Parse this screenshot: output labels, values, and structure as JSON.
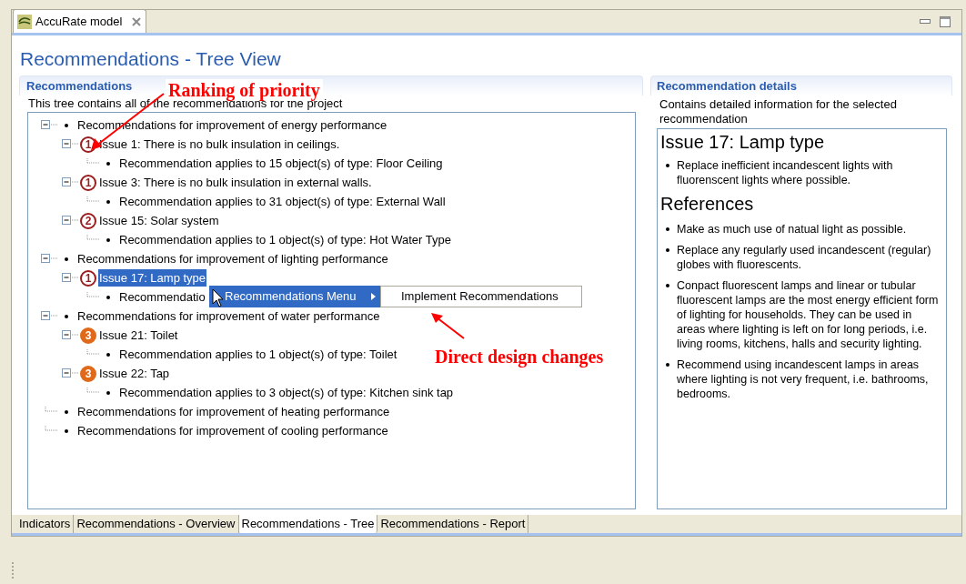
{
  "editor_tab": {
    "title": "AccuRate model"
  },
  "page_title": "Recommendations - Tree View",
  "recommendations_section": {
    "title": "Recommendations",
    "description": "This tree contains all of the recommendations for the project",
    "tree": [
      {
        "label": "Recommendations for improvement of energy performance",
        "expanded": true,
        "children": [
          {
            "label": "Issue 1: There is no bulk insulation in ceilings.",
            "priority": "1",
            "color": "#9b1c1c",
            "expanded": true,
            "selected": false,
            "children": [
              {
                "label": "Recommendation applies to 15 object(s) of type: Floor Ceiling"
              }
            ]
          },
          {
            "label": "Issue 3: There is no bulk insulation in external walls.",
            "priority": "1",
            "color": "#9b1c1c",
            "expanded": true,
            "selected": false,
            "children": [
              {
                "label": "Recommendation applies to 31 object(s) of type: External Wall"
              }
            ]
          },
          {
            "label": "Issue 15: Solar system",
            "priority": "2",
            "color": "#9b1c1c",
            "expanded": true,
            "selected": false,
            "children": [
              {
                "label": "Recommendation applies to 1 object(s) of type: Hot Water Type"
              }
            ]
          }
        ]
      },
      {
        "label": "Recommendations for improvement of lighting performance",
        "expanded": true,
        "children": [
          {
            "label": "Issue 17: Lamp type",
            "priority": "1",
            "color": "#9b1c1c",
            "expanded": true,
            "selected": true,
            "children": [
              {
                "label": "Recommendatio"
              }
            ]
          }
        ]
      },
      {
        "label": "Recommendations for improvement of water performance",
        "expanded": true,
        "children": [
          {
            "label": "Issue 21: Toilet",
            "priority": "3",
            "color": "#e06a1a",
            "expanded": true,
            "selected": false,
            "children": [
              {
                "label": "Recommendation applies to 1 object(s) of type: Toilet"
              }
            ]
          },
          {
            "label": "Issue 22: Tap",
            "priority": "3",
            "color": "#e06a1a",
            "expanded": true,
            "selected": false,
            "children": [
              {
                "label": "Recommendation applies to 3 object(s) of type: Kitchen sink tap"
              }
            ]
          }
        ]
      },
      {
        "label": "Recommendations for improvement of heating performance"
      },
      {
        "label": "Recommendations for improvement of cooling performance"
      }
    ]
  },
  "context_menu": {
    "items": [
      {
        "label": "Recommendations Menu",
        "selected": true
      }
    ],
    "submenu": {
      "items": [
        {
          "label": "Implement Recommendations",
          "selected": false
        }
      ]
    }
  },
  "details_section": {
    "title": "Recommendation details",
    "description": "Contains detailed information for the selected recommendation",
    "heading": "Issue 17: Lamp type",
    "recommendations": [
      "Replace inefficient incandescent lights with fluorenscent lights where possible."
    ],
    "references_heading": "References",
    "references": [
      "Make as much use of natual light as possible.",
      "Replace any regularly used incandescent (regular) globes with fluorescents.",
      "Conpact fluorescent lamps and linear or tubular fluorescent lamps are the most energy efficient form of lighting for households. They can be used in areas where lighting is left on for long periods, i.e. living rooms, kitchens, halls and security lighting.",
      "Recommend using incandescent lamps in areas where lighting is not very frequent, i.e. bathrooms, bedrooms."
    ]
  },
  "bottom_tabs": [
    {
      "label": "Indicators",
      "selected": false
    },
    {
      "label": "Recommendations - Overview",
      "selected": false
    },
    {
      "label": "Recommendations - Tree",
      "selected": true
    },
    {
      "label": "Recommendations - Report",
      "selected": false
    }
  ],
  "annotations": [
    {
      "label": "Ranking of priority"
    },
    {
      "label": "Direct design changes"
    }
  ]
}
